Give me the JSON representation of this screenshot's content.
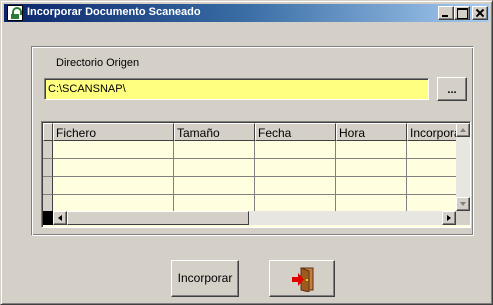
{
  "window": {
    "title": "Incorporar Documento Scaneado",
    "icon": "app-logo-icon"
  },
  "directory": {
    "label": "Directorio Origen",
    "value": "C:\\SCANSNAP\\",
    "browse_label": "..."
  },
  "grid": {
    "columns": [
      "Fichero",
      "Tamaño",
      "Fecha",
      "Hora",
      "Incorpora"
    ],
    "rows": [
      [
        "",
        "",
        "",
        "",
        ""
      ],
      [
        "",
        "",
        "",
        "",
        ""
      ],
      [
        "",
        "",
        "",
        "",
        ""
      ],
      [
        "",
        "",
        "",
        "",
        ""
      ]
    ]
  },
  "buttons": {
    "incorporar_label": "Incorporar",
    "exit_icon": "exit-door-icon"
  },
  "colors": {
    "titlebar_start": "#0a246a",
    "titlebar_end": "#a6caf0",
    "input_bg": "#ffff80",
    "grid_bg": "#ffffe0",
    "face": "#d4d0c8"
  }
}
